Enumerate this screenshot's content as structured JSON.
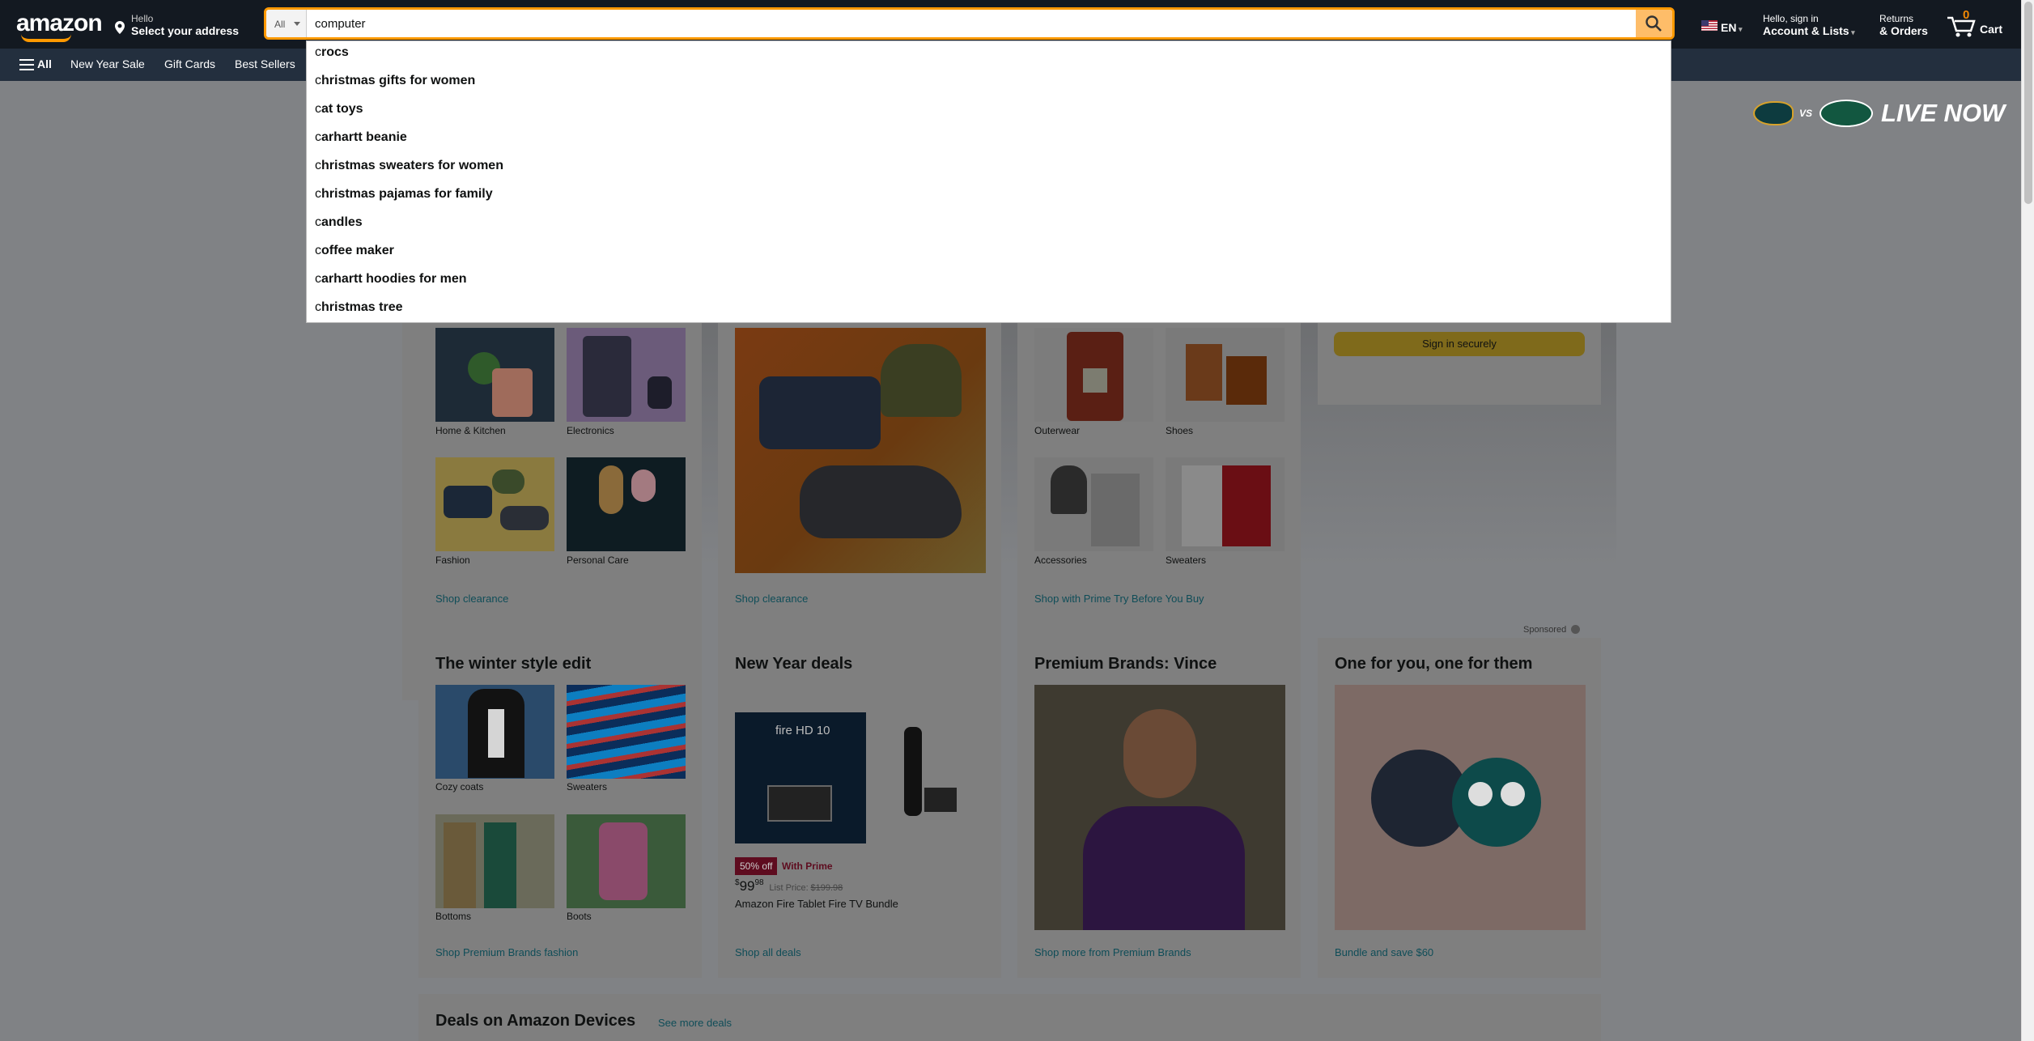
{
  "header": {
    "logo": "amazon",
    "address_line1": "Hello",
    "address_line2": "Select your address",
    "search_category": "All",
    "search_value": "computer",
    "language": "EN",
    "account_line1": "Hello, sign in",
    "account_line2": "Account & Lists",
    "returns_line1": "Returns",
    "returns_line2": "& Orders",
    "cart_count": "0",
    "cart_label": "Cart"
  },
  "subnav": {
    "all": "All",
    "items": [
      "New Year Sale",
      "Gift Cards",
      "Best Sellers"
    ],
    "promo_vs": "VS",
    "promo_live": "LIVE NOW"
  },
  "suggestions": [
    {
      "prefix": "c",
      "rest": "rocs"
    },
    {
      "prefix": "c",
      "rest": "hristmas gifts for women"
    },
    {
      "prefix": "c",
      "rest": "at toys"
    },
    {
      "prefix": "c",
      "rest": "arhartt beanie"
    },
    {
      "prefix": "c",
      "rest": "hristmas sweaters for women"
    },
    {
      "prefix": "c",
      "rest": "hristmas pajamas for family"
    },
    {
      "prefix": "c",
      "rest": "andles"
    },
    {
      "prefix": "c",
      "rest": "offee maker"
    },
    {
      "prefix": "c",
      "rest": "arhartt hoodies for men"
    },
    {
      "prefix": "c",
      "rest": "hristmas tree"
    }
  ],
  "cards_row1": [
    {
      "items": [
        "Home & Kitchen",
        "Electronics",
        "Fashion",
        "Personal Care"
      ],
      "link": "Shop clearance"
    },
    {
      "link": "Shop clearance"
    },
    {
      "items": [
        "Outerwear",
        "Shoes",
        "Accessories",
        "Sweaters"
      ],
      "link": "Shop with Prime Try Before You Buy"
    }
  ],
  "signin_button": "Sign in securely",
  "sponsored": "Sponsored",
  "cards_row2": [
    {
      "title": "The winter style edit",
      "items": [
        "Cozy coats",
        "Sweaters",
        "Bottoms",
        "Boots"
      ],
      "link": "Shop Premium Brands fashion"
    },
    {
      "title": "New Year deals",
      "badge": "50% off",
      "badge_note": "With Prime",
      "price_whole": "99",
      "price_frac": "98",
      "list_price_label": "List Price:",
      "list_price": "$199.98",
      "product": "Amazon Fire Tablet Fire TV Bundle",
      "tablet_text": "fire HD 10",
      "link": "Shop all deals"
    },
    {
      "title": "Premium Brands: Vince",
      "link": "Shop more from Premium Brands"
    },
    {
      "title": "One for you, one for them",
      "link": "Bundle and save $60"
    }
  ],
  "deals": {
    "title": "Deals on Amazon Devices",
    "link": "See more deals"
  },
  "colors": {
    "nav_dark": "#131921",
    "nav_sub": "#232f3e",
    "accent": "#febd69",
    "link": "#007185"
  }
}
